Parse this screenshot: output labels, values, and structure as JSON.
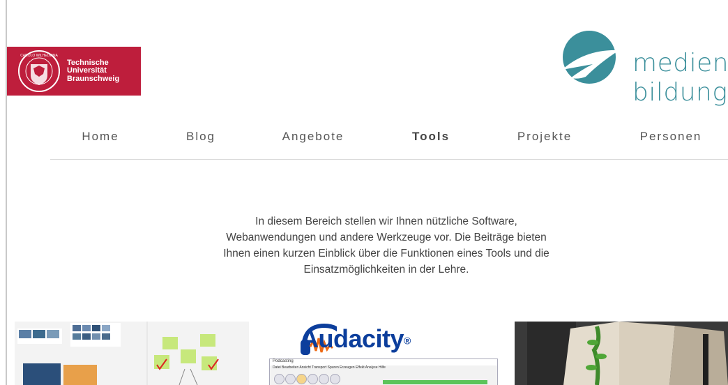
{
  "header": {
    "tu_logo": {
      "line1": "Technische",
      "line2": "Universität",
      "line3": "Braunschweig",
      "color": "#be1e3c"
    },
    "medienbildung_logo": {
      "word1": "medien",
      "word2": "bildung",
      "color": "#3b8f9b"
    }
  },
  "nav": {
    "items": [
      {
        "label": "Home",
        "active": false
      },
      {
        "label": "Blog",
        "active": false
      },
      {
        "label": "Angebote",
        "active": false
      },
      {
        "label": "Tools",
        "active": true
      },
      {
        "label": "Projekte",
        "active": false
      },
      {
        "label": "Personen",
        "active": false
      }
    ]
  },
  "intro": {
    "lines": [
      "In diesem Bereich stellen wir Ihnen nützliche Software,",
      "Webanwendungen und andere Werkzeuge vor. Die Beiträge bieten",
      "Ihnen einen kurzen Einblick über die Funktionen eines Tools und die",
      "Einsatzmöglichkeiten in der Lehre."
    ]
  },
  "thumbnails": {
    "board": {
      "icon": "collaboration-board-image"
    },
    "audacity": {
      "title": "Audacity",
      "trademark": "®",
      "window_title": "Podcasting",
      "menu": "Datei  Bearbeiten  Ansicht  Transport  Spuren  Erzeugen  Effekt  Analyse  Hilfe",
      "brand_color": "#0c3e9c"
    },
    "photo": {
      "icon": "plant-photo-image"
    }
  }
}
